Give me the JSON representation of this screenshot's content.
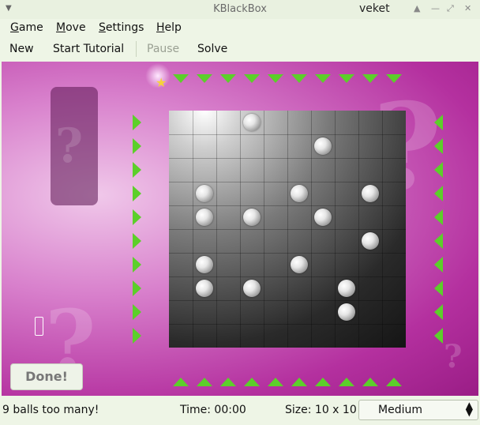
{
  "window": {
    "title": "KBlackBox",
    "user": "veket"
  },
  "menu": {
    "items": [
      {
        "label": "Game",
        "mnemonic": "G"
      },
      {
        "label": "Move",
        "mnemonic": "M"
      },
      {
        "label": "Settings",
        "mnemonic": "S"
      },
      {
        "label": "Help",
        "mnemonic": "H"
      }
    ]
  },
  "toolbar": {
    "new": "New",
    "tutorial": "Start Tutorial",
    "pause": "Pause",
    "solve": "Solve"
  },
  "board": {
    "done_button": "Done!",
    "grid_size": 10,
    "balls": [
      [
        3,
        0
      ],
      [
        6,
        1
      ],
      [
        1,
        3
      ],
      [
        5,
        3
      ],
      [
        8,
        3
      ],
      [
        1,
        4
      ],
      [
        3,
        4
      ],
      [
        6,
        4
      ],
      [
        8,
        5
      ],
      [
        1,
        6
      ],
      [
        5,
        6
      ],
      [
        1,
        7
      ],
      [
        3,
        7
      ],
      [
        7,
        7
      ],
      [
        7,
        8
      ]
    ],
    "colors": {
      "board": "#b4309f",
      "arrow": "#5ccf2a",
      "grid": "#1a1a1a"
    }
  },
  "status": {
    "message": "9 balls too many!",
    "time": "Time: 00:00",
    "size": "Size: 10 x 10",
    "difficulty": "Medium"
  }
}
